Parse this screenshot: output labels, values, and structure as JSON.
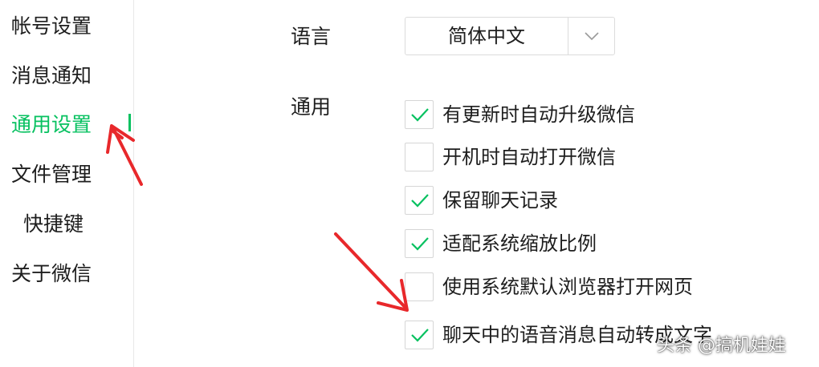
{
  "sidebar": {
    "items": [
      {
        "label": "帐号设置",
        "active": false
      },
      {
        "label": "消息通知",
        "active": false
      },
      {
        "label": "通用设置",
        "active": true
      },
      {
        "label": "文件管理",
        "active": false
      },
      {
        "label": "快捷键",
        "active": false
      },
      {
        "label": "关于微信",
        "active": false
      }
    ]
  },
  "language": {
    "label": "语言",
    "selected": "简体中文",
    "chevron_icon": "chevron-down-icon"
  },
  "general": {
    "label": "通用",
    "options": [
      {
        "label": "有更新时自动升级微信",
        "checked": true
      },
      {
        "label": "开机时自动打开微信",
        "checked": false
      },
      {
        "label": "保留聊天记录",
        "checked": true
      },
      {
        "label": "适配系统缩放比例",
        "checked": true
      },
      {
        "label": "使用系统默认浏览器打开网页",
        "checked": false
      },
      {
        "label": "聊天中的语音消息自动转成文字",
        "checked": true
      }
    ]
  },
  "watermark": "头条 @搞机娃娃",
  "colors": {
    "accent": "#07c160",
    "arrow": "#e8282b",
    "border": "#dcdcdc"
  }
}
